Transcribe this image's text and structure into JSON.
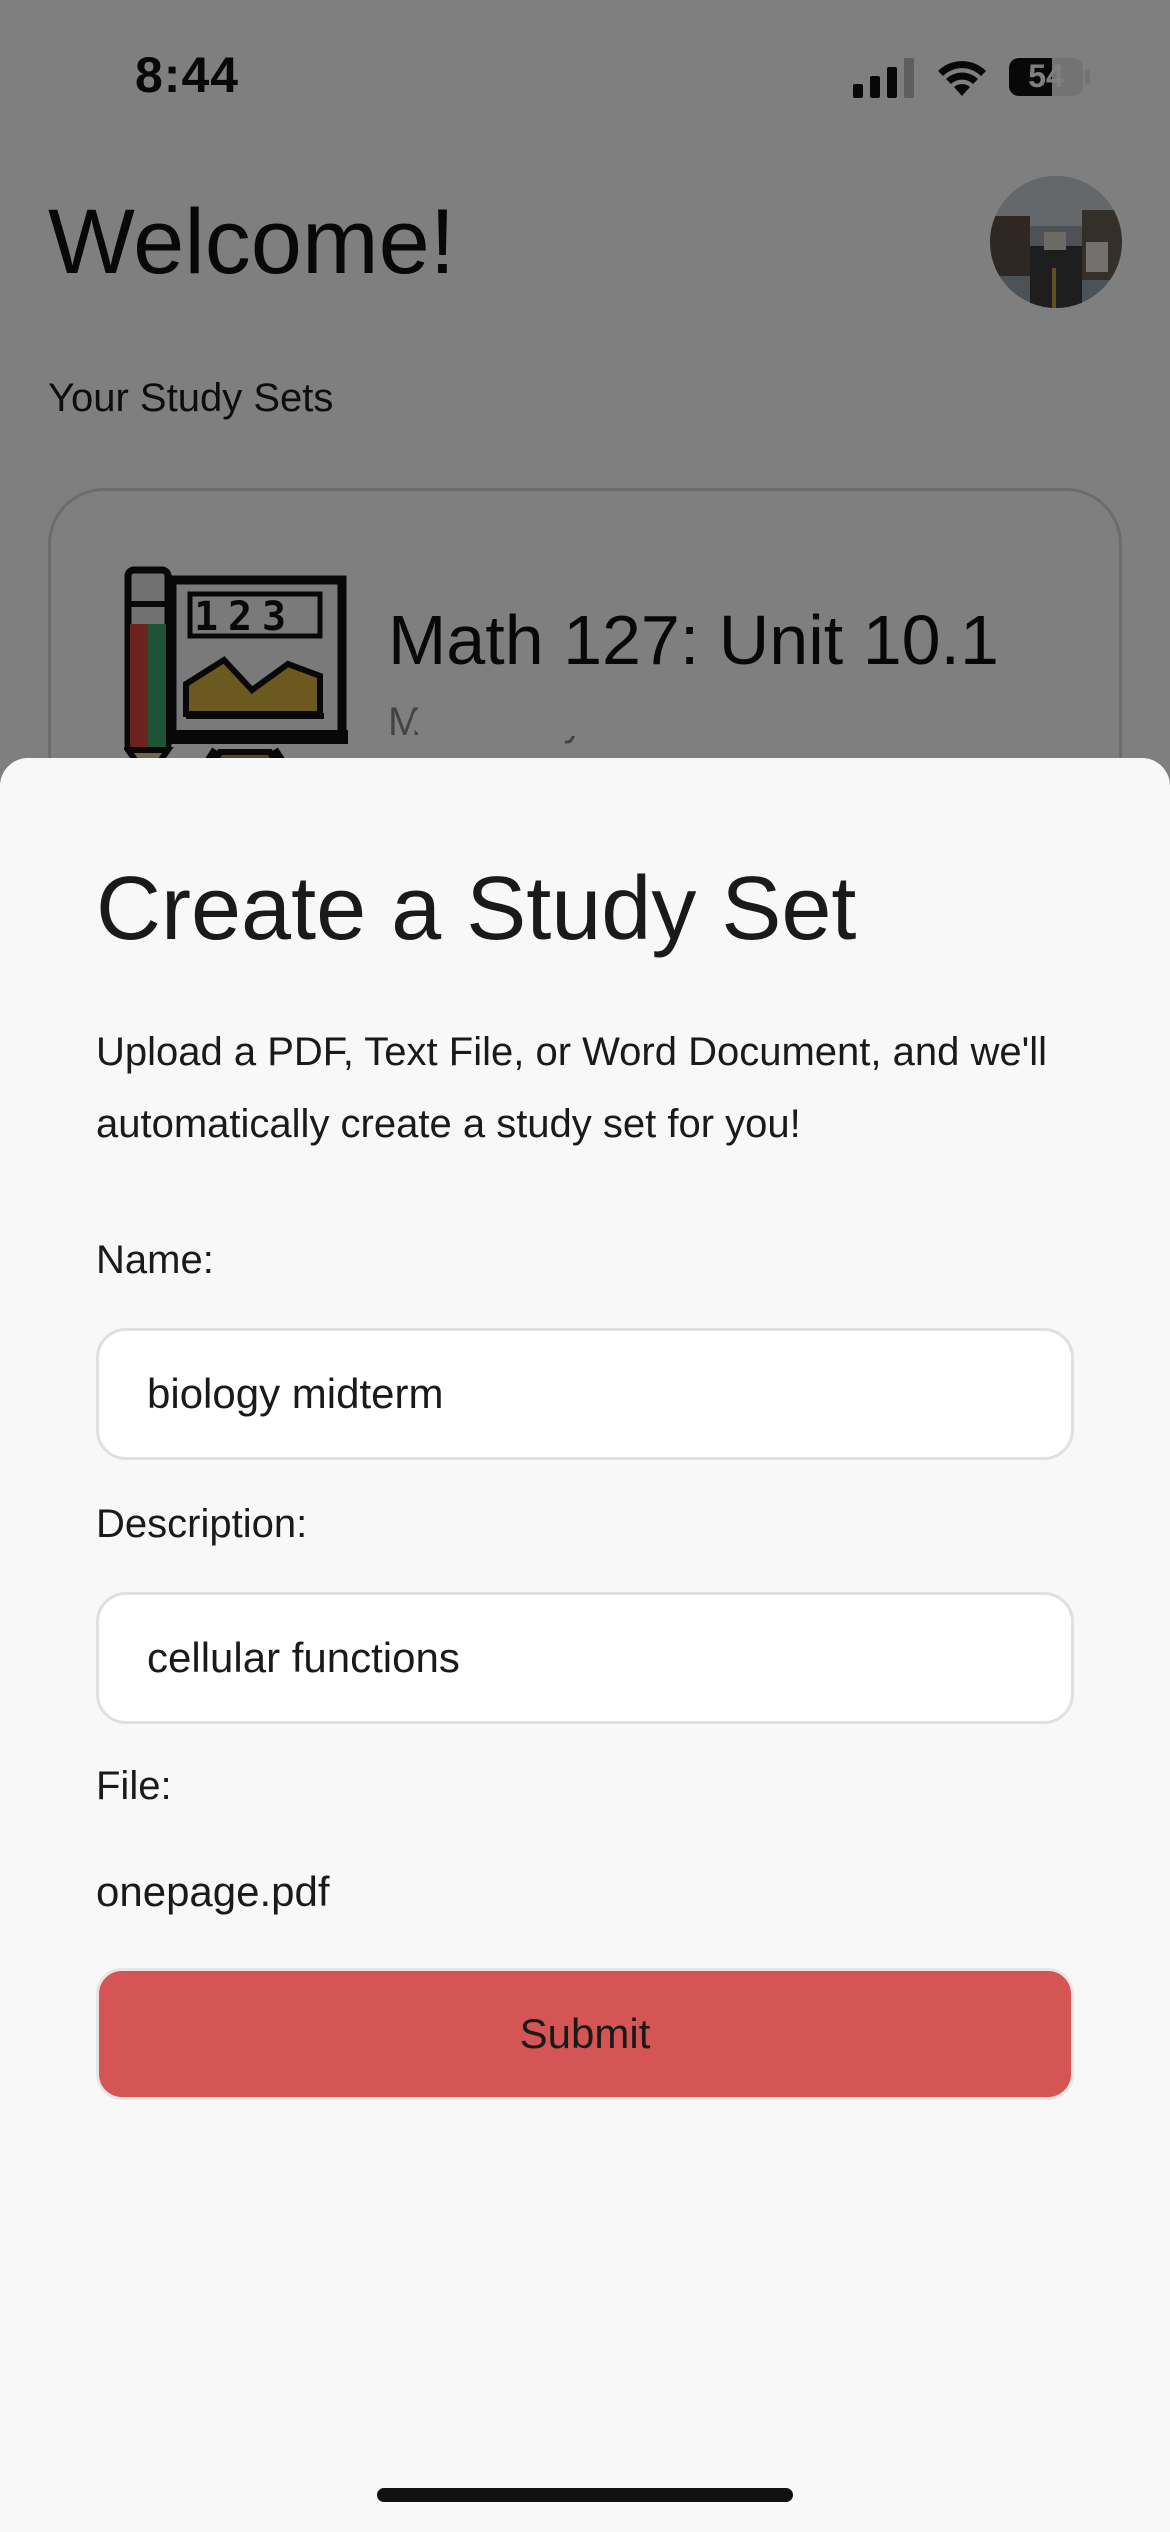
{
  "status_bar": {
    "time": "8:44",
    "battery": "54"
  },
  "home": {
    "welcome": "Welcome!",
    "section_label": "Your Study Sets",
    "study_sets": [
      {
        "title": "Math 127: Unit 10.1",
        "subtitle": "Math study set",
        "icon": "presentation-chart-icon"
      }
    ]
  },
  "modal": {
    "title": "Create a Study Set",
    "description": "Upload a PDF, Text File, or Word Document, and we'll automatically create a study set for you!",
    "name_label": "Name:",
    "name_value": "biology midterm",
    "description_label": "Description:",
    "description_value": "cellular functions",
    "file_label": "File:",
    "file_name": "onepage.pdf",
    "submit_label": "Submit"
  },
  "colors": {
    "accent": "#d55454",
    "sheet_background": "#f8f8f8",
    "overlay": "rgba(0,0,0,0.5)"
  }
}
